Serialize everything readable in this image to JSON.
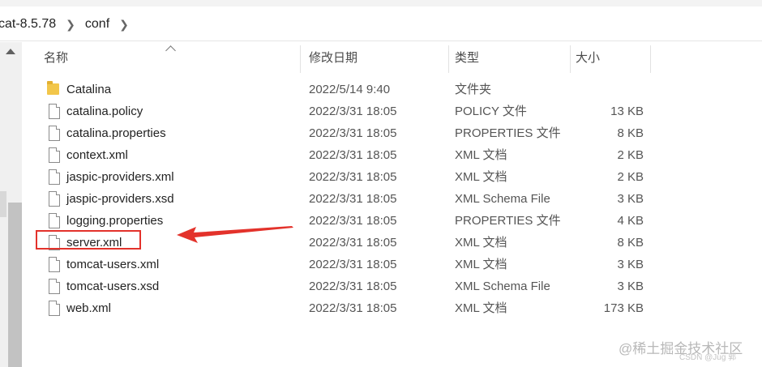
{
  "breadcrumb": {
    "items": [
      "cat-8.5.78",
      "conf"
    ]
  },
  "columns": {
    "name": "名称",
    "date": "修改日期",
    "type": "类型",
    "size": "大小"
  },
  "files": [
    {
      "name": "Catalina",
      "date": "2022/5/14 9:40",
      "type": "文件夹",
      "size": "",
      "icon": "folder-icon"
    },
    {
      "name": "catalina.policy",
      "date": "2022/3/31 18:05",
      "type": "POLICY 文件",
      "size": "13 KB",
      "icon": "file-icon"
    },
    {
      "name": "catalina.properties",
      "date": "2022/3/31 18:05",
      "type": "PROPERTIES 文件",
      "size": "8 KB",
      "icon": "file-icon"
    },
    {
      "name": "context.xml",
      "date": "2022/3/31 18:05",
      "type": "XML 文档",
      "size": "2 KB",
      "icon": "file-icon"
    },
    {
      "name": "jaspic-providers.xml",
      "date": "2022/3/31 18:05",
      "type": "XML 文档",
      "size": "2 KB",
      "icon": "file-icon"
    },
    {
      "name": "jaspic-providers.xsd",
      "date": "2022/3/31 18:05",
      "type": "XML Schema File",
      "size": "3 KB",
      "icon": "file-icon"
    },
    {
      "name": "logging.properties",
      "date": "2022/3/31 18:05",
      "type": "PROPERTIES 文件",
      "size": "4 KB",
      "icon": "file-icon"
    },
    {
      "name": "server.xml",
      "date": "2022/3/31 18:05",
      "type": "XML 文档",
      "size": "8 KB",
      "icon": "file-icon"
    },
    {
      "name": "tomcat-users.xml",
      "date": "2022/3/31 18:05",
      "type": "XML 文档",
      "size": "3 KB",
      "icon": "file-icon"
    },
    {
      "name": "tomcat-users.xsd",
      "date": "2022/3/31 18:05",
      "type": "XML Schema File",
      "size": "3 KB",
      "icon": "file-icon"
    },
    {
      "name": "web.xml",
      "date": "2022/3/31 18:05",
      "type": "XML 文档",
      "size": "173 KB",
      "icon": "file-icon"
    }
  ],
  "annotation": {
    "color": "#e3322b",
    "highlighted_file": "server.xml"
  },
  "watermark": {
    "main": "@稀土掘金技术社区",
    "sub": "CSDN @Jug 郭"
  }
}
